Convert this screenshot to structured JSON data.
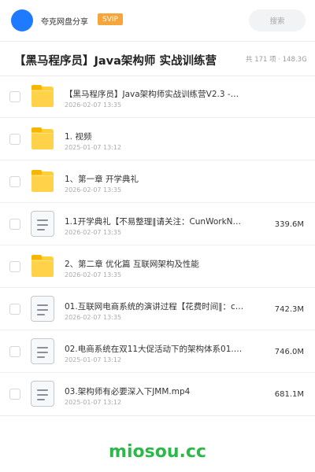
{
  "header": {
    "brand": "夸克网盘分享",
    "badge": "SVIP",
    "search_placeholder": "搜索"
  },
  "folder": {
    "title": "【黑马程序员】Java架构师 实战训练营",
    "summary": "共 171 项 · 148.3G"
  },
  "files": [
    {
      "type": "folder",
      "name": "【黑马程序员】Java架构师实战训练营V2.3 -…",
      "date": "2026-02-07 13:35",
      "size": ""
    },
    {
      "type": "folder",
      "name": "1. 视频",
      "date": "2025-01-07 13:12",
      "size": ""
    },
    {
      "type": "folder",
      "name": "1、第一章 开学典礼",
      "date": "2026-02-07 13:35",
      "size": ""
    },
    {
      "type": "file",
      "name": "1.1开学典礼【不易整理‖请关注：CunWorkN…",
      "date": "2026-02-07 13:35",
      "size": "339.6M"
    },
    {
      "type": "folder",
      "name": "2、第二章 优化篇 互联网架构及性能",
      "date": "2026-02-07 13:35",
      "size": ""
    },
    {
      "type": "file",
      "name": "01.互联网电商系统的演讲过程【花费时间‖：cun…",
      "date": "2026-02-07 13:35",
      "size": "742.3M"
    },
    {
      "type": "file",
      "name": "02.电商系统在双11大促活动下的架构体系01.m…",
      "date": "2025-01-07 13:12",
      "size": "746.0M"
    },
    {
      "type": "file",
      "name": "03.架构师有必要深入下JMM.mp4",
      "date": "2025-01-07 13:12",
      "size": "681.1M"
    }
  ],
  "watermark": "miosou.cc",
  "colors": {
    "accent": "#1e7bff",
    "badge": "#f6a53b",
    "watermark": "#2db84a",
    "folder": "#ffcf3a"
  }
}
